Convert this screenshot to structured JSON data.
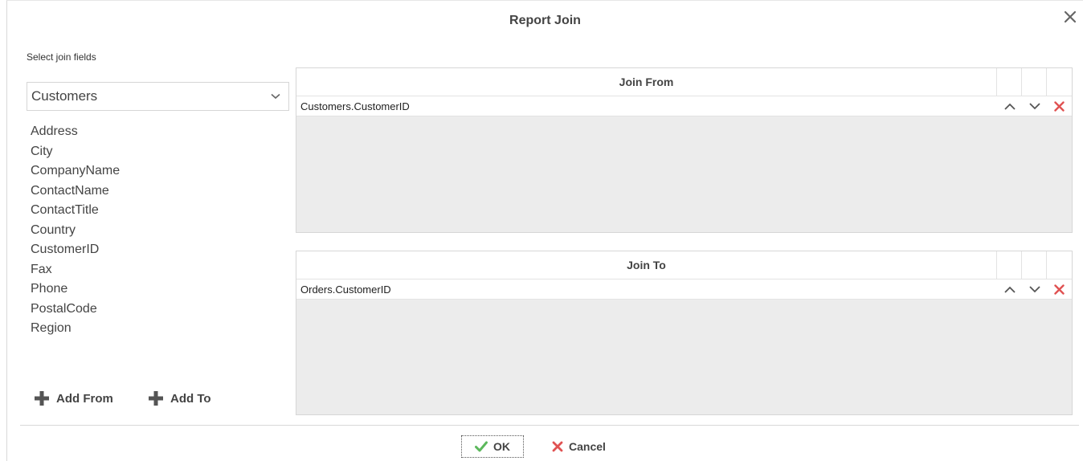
{
  "dialog": {
    "title": "Report Join",
    "subtitle": "Select join fields"
  },
  "table_select": {
    "selected": "Customers"
  },
  "fields": [
    "Address",
    "City",
    "CompanyName",
    "ContactName",
    "ContactTitle",
    "Country",
    "CustomerID",
    "Fax",
    "Phone",
    "PostalCode",
    "Region"
  ],
  "buttons": {
    "add_from": "Add From",
    "add_to": "Add To",
    "ok": "OK",
    "cancel": "Cancel"
  },
  "join_from": {
    "header": "Join From",
    "rows": [
      "Customers.CustomerID"
    ]
  },
  "join_to": {
    "header": "Join To",
    "rows": [
      "Orders.CustomerID"
    ]
  },
  "colors": {
    "ok_check": "#5cb85c",
    "delete_x": "#e05252",
    "panel_bg": "#ececec"
  },
  "icons": [
    "close-icon",
    "chevron-down-icon",
    "plus-icon",
    "chevron-up-icon",
    "delete-icon",
    "check-icon"
  ]
}
